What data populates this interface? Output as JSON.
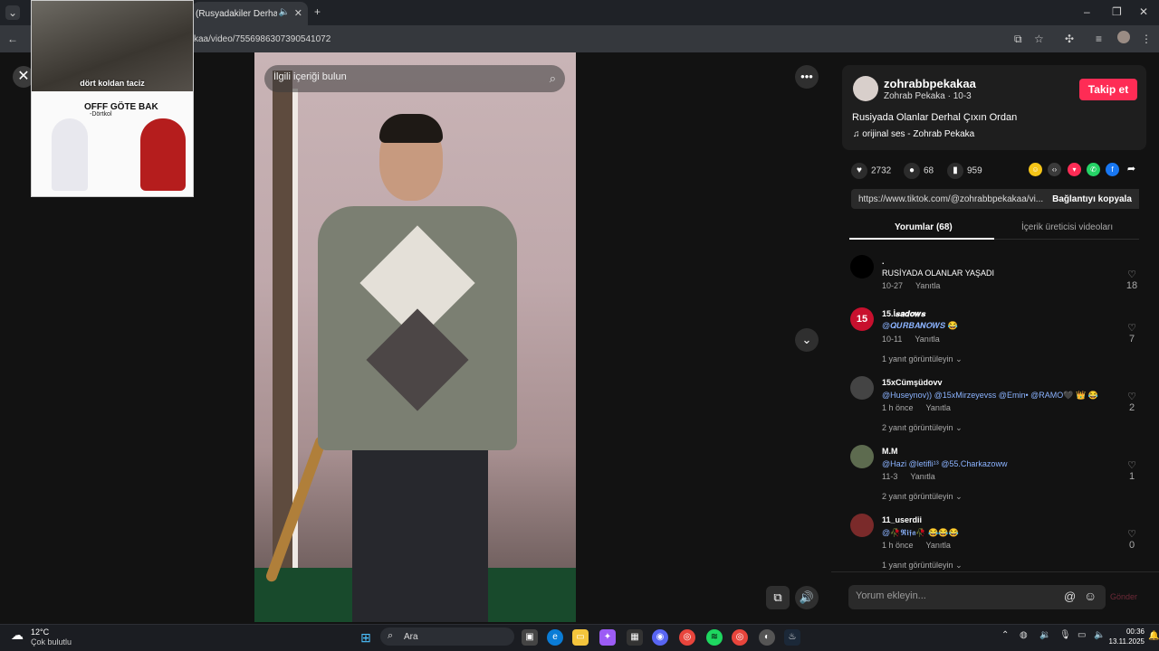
{
  "browser": {
    "tab_title": "(Rusyadakiler Derhal Çıkın",
    "url": "kaa/video/7556986307390541072"
  },
  "pip": {
    "caption": "dört koldan taciz",
    "title": "OFFF GÖTE BAK",
    "subtitle": "-Dörtkol"
  },
  "video": {
    "search_placeholder": "İlgili içeriği bulun"
  },
  "author": {
    "username": "zohrabbpekakaa",
    "nickname_date": "Zohrab Pekaka · 10-3",
    "follow_label": "Takip et",
    "description": "Rusiyada Olanlar Derhal Çıxın Ordan",
    "music": "orijinal ses - Zohrab Pekaka"
  },
  "stats": {
    "likes": "2732",
    "comments": "68",
    "saves": "959"
  },
  "link": {
    "url": "https://www.tiktok.com/@zohrabbpekakaa/vi...",
    "copy_label": "Bağlantıyı kopyala"
  },
  "tabs": {
    "comments": "Yorumlar (68)",
    "creator_videos": "İçerik üreticisi videoları"
  },
  "comments": [
    {
      "name": ".",
      "text": "RUSİYADA OLANLAR YAŞADI",
      "time": "10-27",
      "reply": "Yanıtla",
      "likes": "18",
      "more": ""
    },
    {
      "name": "15.İ𝒔𝒂𝒅𝒐𝒘𝒔",
      "text": "@𝑸𝑼𝑹𝑩𝑨𝑵𝑶𝑾𝑺 😂",
      "time": "10-11",
      "reply": "Yanıtla",
      "likes": "7",
      "more": "1 yanıt görüntüleyin"
    },
    {
      "name": "15xCümşüdovv",
      "text": "@Huseynov)) @15xMirzeyevss @Emin• @RAMO🖤 👑 😂",
      "time": "1 h önce",
      "reply": "Yanıtla",
      "likes": "2",
      "more": "2 yanıt görüntüleyin"
    },
    {
      "name": "M.M",
      "text": "@Hazi @letifli¹³ @55.Charkazoww",
      "time": "11-3",
      "reply": "Yanıtla",
      "likes": "1",
      "more": "2 yanıt görüntüleyin"
    },
    {
      "name": "11_userdii",
      "text": "@🥀𝕽𝖎𝖋𝖆🥀 😂😂😂",
      "time": "1 h önce",
      "reply": "Yanıtla",
      "likes": "0",
      "more": "1 yanıt görüntüleyin"
    }
  ],
  "comment_input": {
    "placeholder": "Yorum ekleyin...",
    "send_label": "Gönder"
  },
  "taskbar": {
    "weather_temp": "12°C",
    "weather_desc": "Çok bulutlu",
    "search_label": "Ara",
    "time": "00:36",
    "date": "13.11.2025"
  },
  "colors": {
    "accent": "#fe2c55",
    "mention": "#8bb3ff",
    "panel_bg": "#121212"
  }
}
